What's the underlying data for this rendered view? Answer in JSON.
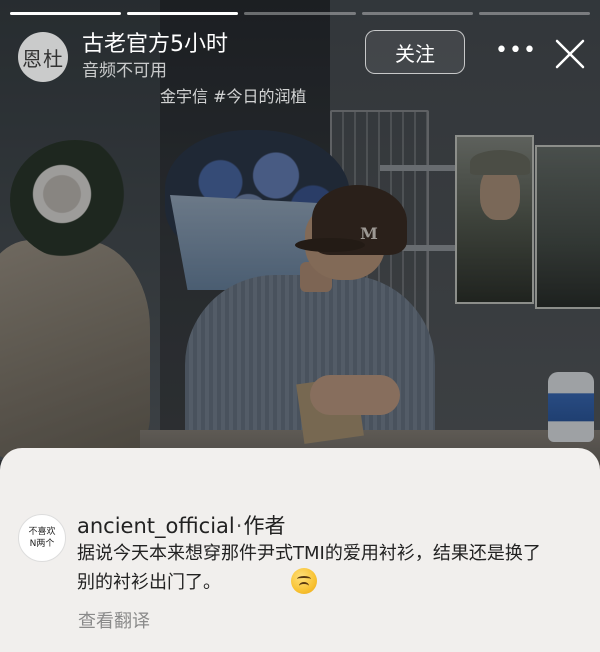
{
  "story": {
    "segments": [
      {
        "fill": 1
      },
      {
        "fill": 1
      },
      {
        "fill": 0
      },
      {
        "fill": 0
      },
      {
        "fill": 0
      }
    ]
  },
  "header": {
    "avatar_text": "恩杜",
    "username": "古老官方5小时",
    "subline": "音频不可用",
    "tag": "金宇信 #今日的润植",
    "follow_label": "关注",
    "more_icon": "more-icon",
    "close_icon": "close-icon"
  },
  "photo": {
    "cap_logo": "M"
  },
  "caption": {
    "avatar_line1": "不喜欢",
    "avatar_line2": "N两个",
    "author": "ancient_official",
    "separator": "·",
    "role": "作者",
    "text_line1": "据说今天本来想穿那件尹式TMI的爱用衬衫，结果还是换了",
    "text_line2": "别的衬衫出门了。",
    "emoji": "upside-down-face-emoji",
    "translate": "查看翻译"
  },
  "colors": {
    "panel_bg": "#f8f6f4",
    "text_primary": "#222222",
    "text_secondary": "#8a8a8a"
  }
}
